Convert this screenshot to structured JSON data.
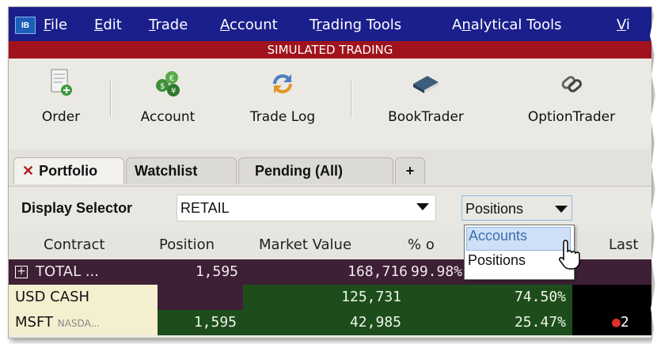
{
  "menubar": {
    "logo": "IB",
    "items": [
      {
        "pre": "",
        "u": "F",
        "post": "ile"
      },
      {
        "pre": "",
        "u": "E",
        "post": "dit"
      },
      {
        "pre": "",
        "u": "T",
        "post": "rade"
      },
      {
        "pre": "",
        "u": "A",
        "post": "ccount"
      },
      {
        "pre": "T",
        "u": "r",
        "post": "ading Tools"
      },
      {
        "pre": "A",
        "u": "n",
        "post": "alytical Tools"
      },
      {
        "pre": "",
        "u": "V",
        "post": "i"
      }
    ]
  },
  "banner": "SIMULATED TRADING",
  "toolbar": {
    "order": "Order",
    "account": "Account",
    "trade_log": "Trade Log",
    "book_trader": "BookTrader",
    "option_trader": "OptionTrader"
  },
  "tabs": {
    "close_glyph": "✕",
    "portfolio": "Portfolio",
    "watchlist": "Watchlist",
    "pending": "Pending (All)",
    "add": "+"
  },
  "selector": {
    "label": "Display Selector",
    "value": "RETAIL",
    "view_value": "Positions"
  },
  "columns": [
    "Contract",
    "Position",
    "Market Value",
    "% o",
    "Last"
  ],
  "rows": {
    "total": {
      "contract": "TOTAL ...",
      "position": "1,595",
      "market_value": "168,716",
      "pct": "99.98%"
    },
    "usd": {
      "contract": "USD CASH",
      "position": "",
      "market_value": "125,731",
      "pct": "74.50%"
    },
    "msft": {
      "contract": "MSFT",
      "exchange": "NASDA...",
      "position": "1,595",
      "market_value": "42,985",
      "pct": "25.47%",
      "last": "2"
    }
  },
  "dropdown": {
    "options": [
      "Accounts",
      "Positions"
    ],
    "highlighted": "Accounts"
  },
  "colors": {
    "menubar": "#1a1f8c",
    "banner": "#a0121c",
    "total_row": "#3d2035",
    "positive_green": "#1e4d1c",
    "cell_beige": "#f3efcf"
  }
}
